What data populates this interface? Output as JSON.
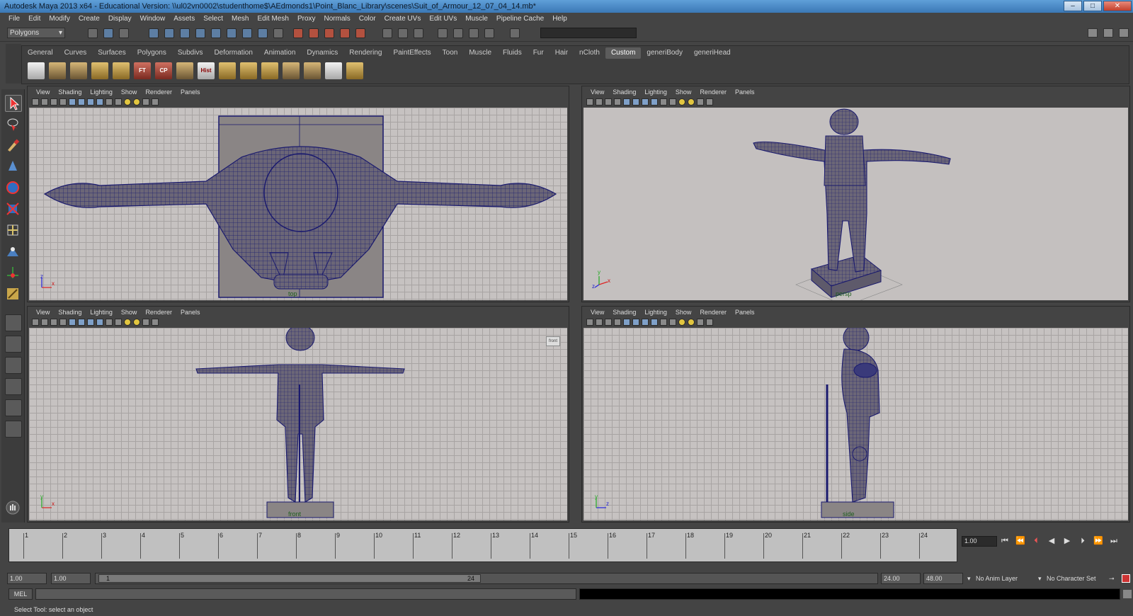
{
  "window": {
    "title": "Autodesk Maya 2013 x64 - Educational Version: \\\\ul02vn0002\\studenthome$\\AEdmonds1\\Point_Blanc_Library\\scenes\\Suit_of_Armour_12_07_04_14.mb*"
  },
  "menubar": [
    "File",
    "Edit",
    "Modify",
    "Create",
    "Display",
    "Window",
    "Assets",
    "Select",
    "Mesh",
    "Edit Mesh",
    "Proxy",
    "Normals",
    "Color",
    "Create UVs",
    "Edit UVs",
    "Muscle",
    "Pipeline Cache",
    "Help"
  ],
  "status_line": {
    "mode": "Polygons"
  },
  "shelf": {
    "tabs": [
      "General",
      "Curves",
      "Surfaces",
      "Polygons",
      "Subdivs",
      "Deformation",
      "Animation",
      "Dynamics",
      "Rendering",
      "PaintEffects",
      "Toon",
      "Muscle",
      "Fluids",
      "Fur",
      "Hair",
      "nCloth",
      "Custom",
      "generiBody",
      "generiHead"
    ],
    "active_tab": "Custom",
    "button_labels": {
      "ft": "FT",
      "cp": "CP",
      "hist": "Hist"
    }
  },
  "panel_menu": [
    "View",
    "Shading",
    "Lighting",
    "Show",
    "Renderer",
    "Panels"
  ],
  "viewports": {
    "top_left": {
      "camera": "top"
    },
    "top_right": {
      "camera": "persp"
    },
    "bottom_left": {
      "camera": "front"
    },
    "bottom_right": {
      "camera": "side"
    }
  },
  "axis_labels": {
    "x": "x",
    "y": "y",
    "z": "z"
  },
  "timeline": {
    "frames": [
      "1",
      "2",
      "3",
      "4",
      "5",
      "6",
      "7",
      "8",
      "9",
      "10",
      "11",
      "12",
      "13",
      "14",
      "15",
      "16",
      "17",
      "18",
      "19",
      "20",
      "21",
      "22",
      "23",
      "24"
    ],
    "current_frame": "1.00"
  },
  "range": {
    "start": "1.00",
    "playback_start": "1.00",
    "slider_start": "1",
    "slider_end": "24",
    "playback_end": "24.00",
    "end": "48.00",
    "anim_layer": "No Anim Layer",
    "character_set": "No Character Set"
  },
  "command_line": {
    "label": "MEL"
  },
  "help_line": "Select Tool: select an object",
  "colors": {
    "wire": "#1a1a6e",
    "mesh": "#6e6a7a",
    "viewport_bg": "#c6c2c1",
    "title_bar": "#4f8fcd"
  }
}
